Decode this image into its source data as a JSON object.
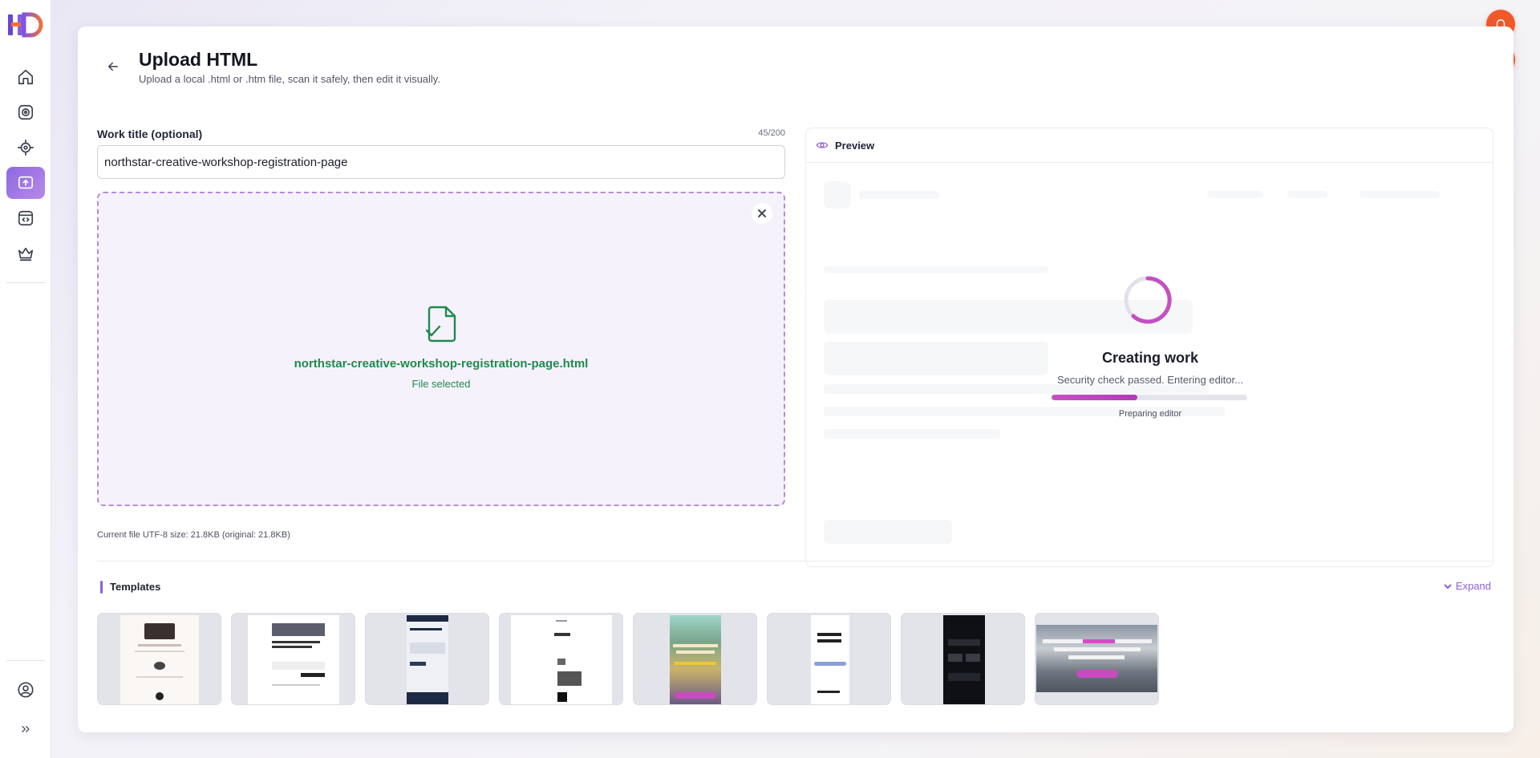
{
  "app": {
    "logo_text": "HD",
    "accent": "#8c68e0",
    "alert_color": "#f1592a"
  },
  "sidebar": {
    "items": [
      {
        "name": "home-icon"
      },
      {
        "name": "camera-icon"
      },
      {
        "name": "target-icon"
      },
      {
        "name": "upload-icon",
        "active": true
      },
      {
        "name": "code-window-icon"
      },
      {
        "name": "crown-icon"
      }
    ],
    "bottom": [
      {
        "name": "user-circle-icon"
      },
      {
        "name": "double-chevron-right-icon"
      }
    ]
  },
  "header": {
    "title": "Upload HTML",
    "subtitle": "Upload a local .html or .htm file, scan it safely, then edit it visually."
  },
  "form": {
    "title_label": "Work title (optional)",
    "char_count": "45/200",
    "title_value": "northstar-creative-workshop-registration-page"
  },
  "dropzone": {
    "file_name": "northstar-creative-workshop-registration-page.html",
    "status": "File selected",
    "status_color": "#1f8a4c"
  },
  "file_size_note": "Current file UTF-8 size: 21.8KB (original: 21.8KB)",
  "preview": {
    "title": "Preview",
    "creating_title": "Creating work",
    "security_message": "Security check passed. Entering editor...",
    "progress_label": "Preparing editor",
    "progress": 0.44
  },
  "templates": {
    "title": "Templates",
    "expand_label": "Expand",
    "count": 8
  }
}
